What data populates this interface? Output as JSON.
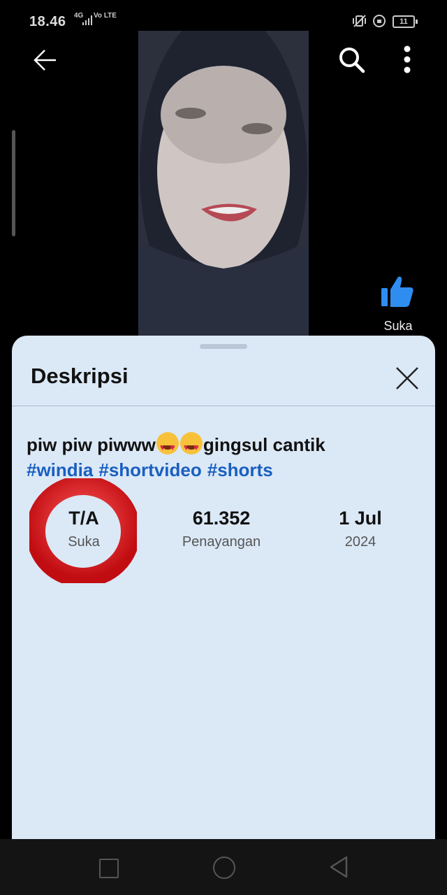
{
  "status_bar": {
    "time": "18.46",
    "network": "4G",
    "volte": "Vo LTE",
    "battery": "11"
  },
  "icons": {
    "back": "arrow-left-icon",
    "search": "search-icon",
    "more": "more-vertical-icon",
    "like": "thumbs-up-icon",
    "close": "close-icon"
  },
  "like": {
    "label": "Suka"
  },
  "sheet": {
    "title": "Deskripsi",
    "description_pre": "piw piw piwww",
    "description_post": "gingsul cantik",
    "hashtags": [
      "#windia",
      "#shortvideo",
      "#shorts"
    ],
    "stats": [
      {
        "value": "T/A",
        "label": "Suka"
      },
      {
        "value": "61.352",
        "label": "Penayangan"
      },
      {
        "value": "1 Jul",
        "label": "2024"
      }
    ]
  },
  "colors": {
    "sheet_bg": "#dbe8f6",
    "hashtag": "#1a5fc0",
    "like_blue": "#2f8df0",
    "ring_red": "#e2151b"
  }
}
